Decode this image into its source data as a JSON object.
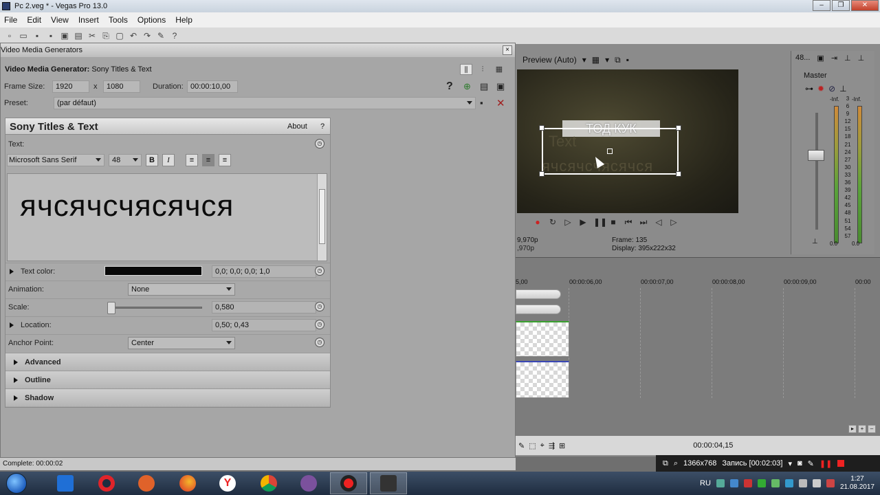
{
  "app": {
    "window_title": "Pc 2.veg * - Vegas Pro 13.0",
    "window_buttons": [
      "–",
      "❐",
      "✕"
    ]
  },
  "menu": [
    "File",
    "Edit",
    "View",
    "Insert",
    "Tools",
    "Options",
    "Help"
  ],
  "dialog": {
    "title": "Video Media Generators",
    "generator_label": "Video Media Generator:",
    "generator_name": "Sony Titles & Text",
    "frame_size_label": "Frame Size:",
    "frame_width": "1920",
    "frame_x": "x",
    "frame_height": "1080",
    "duration_label": "Duration:",
    "duration": "00:00:10,00",
    "preset_label": "Preset:",
    "preset_value": "(par défaut)",
    "help": "?"
  },
  "titles_panel": {
    "heading": "Sony Titles & Text",
    "about": "About",
    "about_q": "?",
    "text_label": "Text:",
    "font": "Microsoft Sans Serif",
    "size": "48",
    "bold": "B",
    "italic": "I",
    "content": "ячсячсчясячся",
    "props": {
      "text_color_label": "Text color:",
      "text_color_value": "0,0; 0,0; 0,0; 1,0",
      "animation_label": "Animation:",
      "animation_value": "None",
      "scale_label": "Scale:",
      "scale_value": "0,580",
      "location_label": "Location:",
      "location_value": "0,50; 0,43",
      "anchor_label": "Anchor Point:",
      "anchor_value": "Center"
    },
    "sections": [
      "Advanced",
      "Outline",
      "Shadow"
    ]
  },
  "preview": {
    "mode": "Preview (Auto)",
    "overlay_title": "ТОД КУК",
    "overlay_text1": "Text",
    "overlay_text2": "ячсячсчясячся",
    "left_line1": "9,970p",
    "left_line2": ",970p",
    "frame_line": "Frame:    135",
    "display_line": "Display:   395x222x32"
  },
  "mixer": {
    "head_value": "48...",
    "label": "Master",
    "left_inf": "-Inf.",
    "right_inf": "-Inf.",
    "scale": [
      "3",
      "6",
      "9",
      "12",
      "15",
      "18",
      "21",
      "24",
      "27",
      "30",
      "33",
      "36",
      "39",
      "42",
      "45",
      "48",
      "51",
      "54",
      "57"
    ],
    "bottom_left": "0.0",
    "bottom_right": "0.0"
  },
  "timeline": {
    "ruler": [
      "5,00",
      "00:00:06,00",
      "00:00:07,00",
      "00:00:08,00",
      "00:00:09,00",
      "00:00"
    ],
    "timecode": "00:00:04,15"
  },
  "status": {
    "text": "Complete: 00:00:02"
  },
  "recorder": {
    "resolution": "1366x768",
    "record": "Запись [00:02:03]"
  },
  "taskbar": {
    "lang": "RU",
    "time": "1:27",
    "date": "21.08.2017"
  },
  "colors": {
    "accent": "#2a3e6e",
    "text_color": "#000000"
  }
}
